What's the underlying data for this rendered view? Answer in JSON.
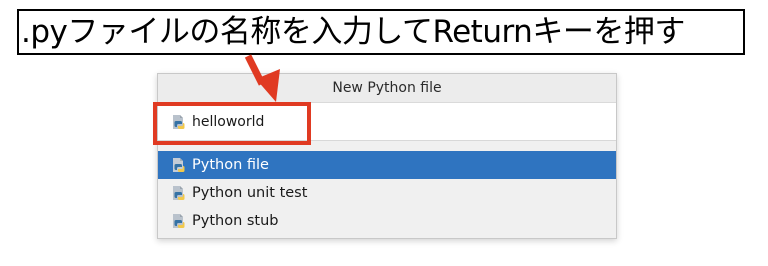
{
  "annotation": {
    "instruction_text": ".pyファイルの名称を入力してReturnキーを押す",
    "highlight_color": "#e03a22"
  },
  "dialog": {
    "title": "New Python file",
    "name_field": {
      "value": "helloworld",
      "icon": "python-file-icon"
    },
    "file_types": [
      {
        "label": "Python file",
        "icon": "python-file-icon",
        "selected": true
      },
      {
        "label": "Python unit test",
        "icon": "python-file-icon",
        "selected": false
      },
      {
        "label": "Python stub",
        "icon": "python-file-icon",
        "selected": false
      }
    ],
    "selection_color": "#2f74c0"
  }
}
